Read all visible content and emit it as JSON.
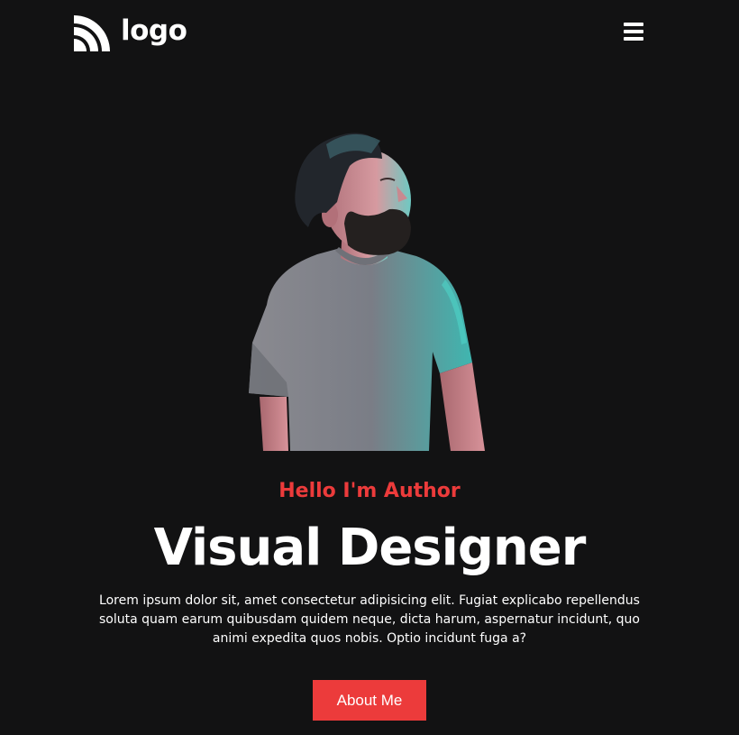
{
  "header": {
    "logo_text": "logo",
    "logo_icon": "signal-waves-icon",
    "menu_icon": "hamburger-menu-icon"
  },
  "hero": {
    "image_alt": "Portrait of a bearded man in a grey t-shirt looking up",
    "greeting": "Hello I'm Author",
    "title": "Visual Designer",
    "description": "Lorem ipsum dolor sit, amet consectetur adipisicing elit. Fugiat explicabo repellendus soluta quam earum quibusdam quidem neque, dicta harum, aspernatur incidunt, quo animi expedita quos nobis. Optio incidunt fuga a?",
    "button_label": "About Me"
  },
  "colors": {
    "background": "#121213",
    "accent": "#ec3b3b",
    "text": "#ffffff"
  }
}
